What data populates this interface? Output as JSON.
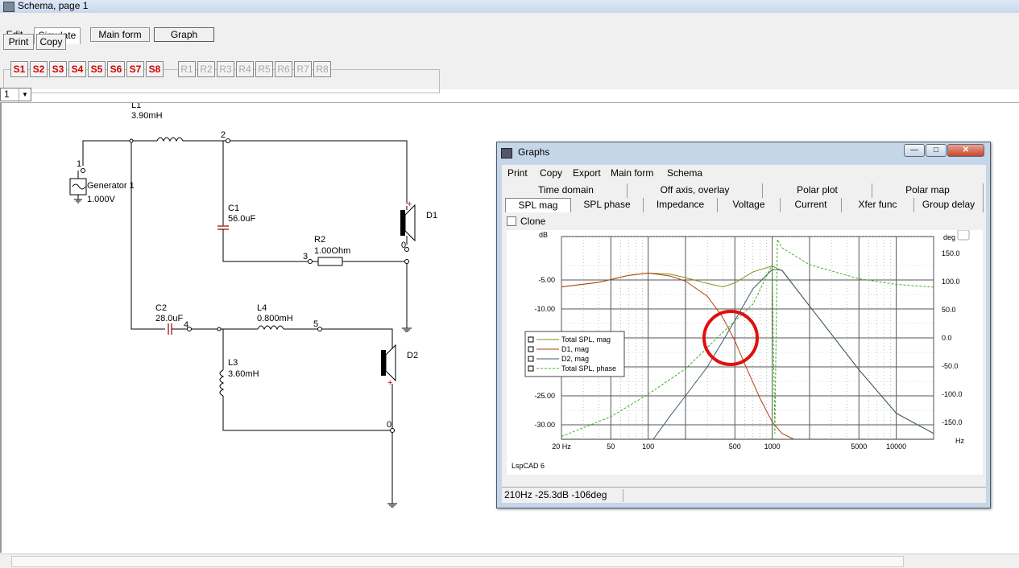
{
  "window": {
    "title": "Schema, page 1"
  },
  "menu": {
    "edit": "Edit",
    "simulate": "Simulate"
  },
  "toolbar": {
    "main_form": "Main form",
    "graph": "Graph",
    "print": "Print",
    "copy": "Copy"
  },
  "sim_buttons": [
    "S1",
    "S2",
    "S3",
    "S4",
    "S5",
    "S6",
    "S7",
    "S8"
  ],
  "ref_buttons": [
    "R1",
    "R2",
    "R3",
    "R4",
    "R5",
    "R6",
    "R7",
    "R8"
  ],
  "page_select": {
    "value": "1"
  },
  "colors": {
    "s_button": "#d00000",
    "r_button": "#a8a8a8",
    "highlight_circle": "#e01010"
  },
  "schematic": {
    "generator": {
      "name": "Generator 1",
      "voltage": "1.000V"
    },
    "nodes": [
      "1",
      "2",
      "3",
      "4",
      "5",
      "0",
      "0",
      "0"
    ],
    "L1": {
      "name": "L1",
      "value": "3.90mH"
    },
    "C1": {
      "name": "C1",
      "value": "56.0uF"
    },
    "R2": {
      "name": "R2",
      "value": "1.00Ohm"
    },
    "C2": {
      "name": "C2",
      "value": "28.0uF"
    },
    "L4": {
      "name": "L4",
      "value": "0.800mH"
    },
    "L3": {
      "name": "L3",
      "value": "3.60mH"
    },
    "D1": "D1",
    "D2": "D2"
  },
  "graphs": {
    "title": "Graphs",
    "menu": [
      "Print",
      "Copy",
      "Export",
      "Main form",
      "Schema"
    ],
    "tabs_row1": [
      "Time domain",
      "Off axis, overlay",
      "Polar plot",
      "Polar map"
    ],
    "tabs_row2": [
      "SPL mag",
      "SPL phase",
      "Impedance",
      "Voltage",
      "Current",
      "Xfer func",
      "Group delay"
    ],
    "clone_label": "Clone",
    "watermark": "LspCAD 6",
    "status": "210Hz -25.3dB -106deg"
  },
  "chart_data": {
    "type": "line",
    "xscale": "log",
    "xlim": [
      20,
      20000
    ],
    "ylim": [
      -32.5,
      2.5
    ],
    "y2lim": [
      -180,
      180
    ],
    "ylabel": "dB",
    "y2label": "deg",
    "xlabel": "Hz",
    "x_ticks": [
      "20 Hz",
      "50",
      "100",
      "500",
      "1000",
      "5000",
      "10000"
    ],
    "x_tick_values": [
      20,
      50,
      100,
      500,
      1000,
      5000,
      10000
    ],
    "y_ticks": [
      "-5.00",
      "-10.00",
      "-15.00",
      "-20.00",
      "-25.00",
      "-30.00"
    ],
    "y_tick_values": [
      -5,
      -10,
      -15,
      -20,
      -25,
      -30
    ],
    "y2_ticks": [
      "150.0",
      "100.0",
      "50.0",
      "0.0",
      "-50.0",
      "-100.0",
      "-150.0"
    ],
    "y2_tick_values": [
      150,
      100,
      50,
      0,
      -50,
      -100,
      -150
    ],
    "grid": true,
    "legend_position": "left",
    "series": [
      {
        "name": "Total SPL, mag",
        "color": "#8a8a1a",
        "axis": "left",
        "x": [
          20,
          40,
          70,
          100,
          150,
          200,
          300,
          400,
          500,
          700,
          1000,
          1200,
          2000,
          5000,
          10000,
          20000
        ],
        "y": [
          -6.2,
          -5.4,
          -4.2,
          -3.8,
          -4.0,
          -4.6,
          -5.6,
          -6.2,
          -5.5,
          -3.6,
          -2.6,
          -3.4,
          -9.5,
          -20.5,
          -28.0,
          -31.5
        ]
      },
      {
        "name": "D1, mag",
        "color": "#b04010",
        "axis": "left",
        "x": [
          20,
          40,
          70,
          100,
          150,
          200,
          300,
          400,
          500,
          600,
          800,
          1000,
          1200,
          1500
        ],
        "y": [
          -6.2,
          -5.4,
          -4.2,
          -3.8,
          -4.3,
          -5.2,
          -7.8,
          -11.5,
          -15.5,
          -19.5,
          -25.5,
          -29.5,
          -31.5,
          -33
        ]
      },
      {
        "name": "D2, mag",
        "color": "#3a5a70",
        "axis": "left",
        "x": [
          110,
          150,
          200,
          300,
          400,
          500,
          700,
          1000,
          1200,
          2000,
          5000,
          10000,
          20000
        ],
        "y": [
          -33,
          -28.5,
          -25.0,
          -20.0,
          -15.5,
          -12.0,
          -6.5,
          -3.2,
          -3.3,
          -9.5,
          -20.5,
          -28.0,
          -31.5
        ]
      },
      {
        "name": "Total SPL, phase",
        "color": "#40b020",
        "axis": "right",
        "x": [
          20,
          50,
          100,
          200,
          400,
          700,
          1000,
          1050,
          1100,
          1200,
          2000,
          5000,
          10000,
          20000
        ],
        "y": [
          -175,
          -140,
          -100,
          -55,
          10,
          60,
          130,
          -170,
          175,
          160,
          130,
          105,
          95,
          90
        ]
      }
    ]
  }
}
